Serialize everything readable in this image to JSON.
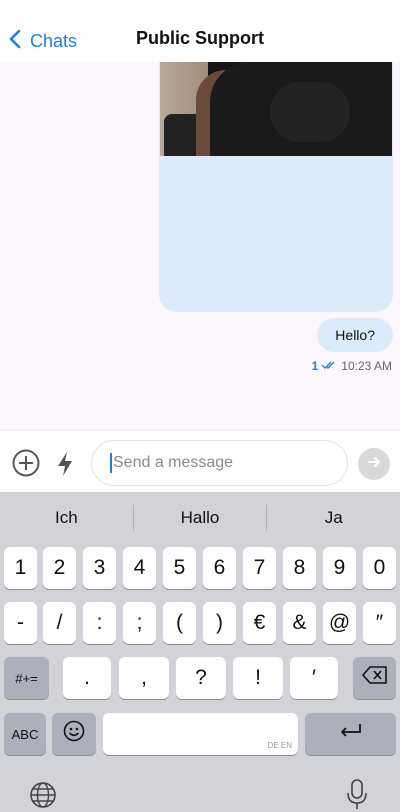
{
  "header": {
    "back_label": "Chats",
    "title": "Public Support"
  },
  "messages": {
    "text": "Hello?",
    "read_count": "1",
    "time": "10:23 AM"
  },
  "composer": {
    "placeholder": "Send a message"
  },
  "keyboard": {
    "suggestions": [
      "Ich",
      "Hallo",
      "Ja"
    ],
    "row1": [
      "1",
      "2",
      "3",
      "4",
      "5",
      "6",
      "7",
      "8",
      "9",
      "0"
    ],
    "row2": [
      "-",
      "/",
      ":",
      ";",
      "(",
      ")",
      "€",
      "&",
      "@",
      "″"
    ],
    "row3": [
      ".",
      ",",
      "?",
      "!",
      "′"
    ],
    "symbols_key": "#+=",
    "abc_key": "ABC",
    "space_lang": "DE EN"
  },
  "colors": {
    "accent": "#1f7ee0",
    "bubble": "#dcebfb",
    "chat_bg": "#fcf7fc",
    "keyboard_bg": "#d1d3d9"
  }
}
